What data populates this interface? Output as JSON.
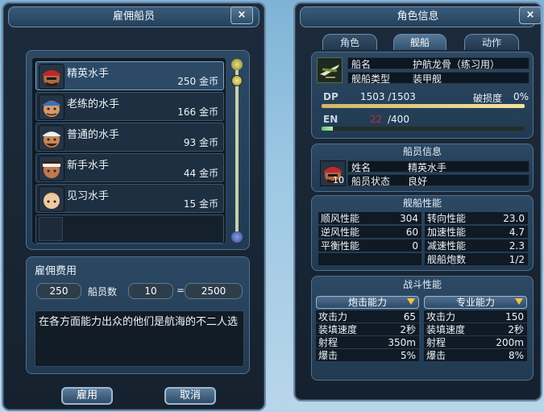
{
  "hire_window": {
    "title": "雇佣船员",
    "close_label": "×",
    "crew_options": [
      {
        "name": "精英水手",
        "price": "250 金币"
      },
      {
        "name": "老练的水手",
        "price": "166 金币"
      },
      {
        "name": "普通的水手",
        "price": "93 金币"
      },
      {
        "name": "新手水手",
        "price": "44 金币"
      },
      {
        "name": "见习水手",
        "price": "15 金币"
      }
    ],
    "cost_section_title": "雇佣费用",
    "unit_cost": "250",
    "crew_count_label": "船员数",
    "crew_count": "10",
    "equals": "=",
    "total_cost": "2500",
    "description": "在各方面能力出众的他们是航海的不二人选",
    "hire_button": "雇用",
    "cancel_button": "取消"
  },
  "char_window": {
    "title": "角色信息",
    "close_label": "×",
    "tabs": [
      "角色",
      "舰船",
      "动作"
    ],
    "active_tab": "舰船",
    "ship": {
      "name_label": "船名",
      "name_value": "护航龙骨（练习用）",
      "type_label": "舰船类型",
      "type_value": "装甲舰",
      "dp_label": "DP",
      "dp_value": "1503 /1503",
      "dp_fraction": 1.0,
      "damage_label": "破损度",
      "damage_value": "0%",
      "en_label": "EN",
      "en_current": "22",
      "en_max": "/400",
      "en_fraction": 0.055
    },
    "crew_info": {
      "title": "船员信息",
      "avatar_count": "10",
      "name_label": "姓名",
      "name_value": "精英水手",
      "status_label": "船员状态",
      "status_value": "良好"
    },
    "performance": {
      "title": "舰船性能",
      "left": [
        {
          "label": "顺风性能",
          "value": "304"
        },
        {
          "label": "逆风性能",
          "value": "60"
        },
        {
          "label": "平衡性能",
          "value": "0"
        }
      ],
      "right": [
        {
          "label": "转向性能",
          "value": "23.0"
        },
        {
          "label": "加速性能",
          "value": "4.7"
        },
        {
          "label": "减速性能",
          "value": "2.3"
        },
        {
          "label": "舰船炮数",
          "value": "1/2"
        }
      ]
    },
    "battle": {
      "title": "战斗性能",
      "left_head": "炮击能力",
      "right_head": "专业能力",
      "left": [
        {
          "label": "攻击力",
          "value": "65"
        },
        {
          "label": "装填速度",
          "value": "2秒"
        },
        {
          "label": "射程",
          "value": "350m"
        },
        {
          "label": "爆击",
          "value": "5%"
        }
      ],
      "right": [
        {
          "label": "攻击力",
          "value": "150"
        },
        {
          "label": "装填速度",
          "value": "2秒"
        },
        {
          "label": "射程",
          "value": "200m"
        },
        {
          "label": "爆击",
          "value": "8%"
        }
      ]
    }
  }
}
